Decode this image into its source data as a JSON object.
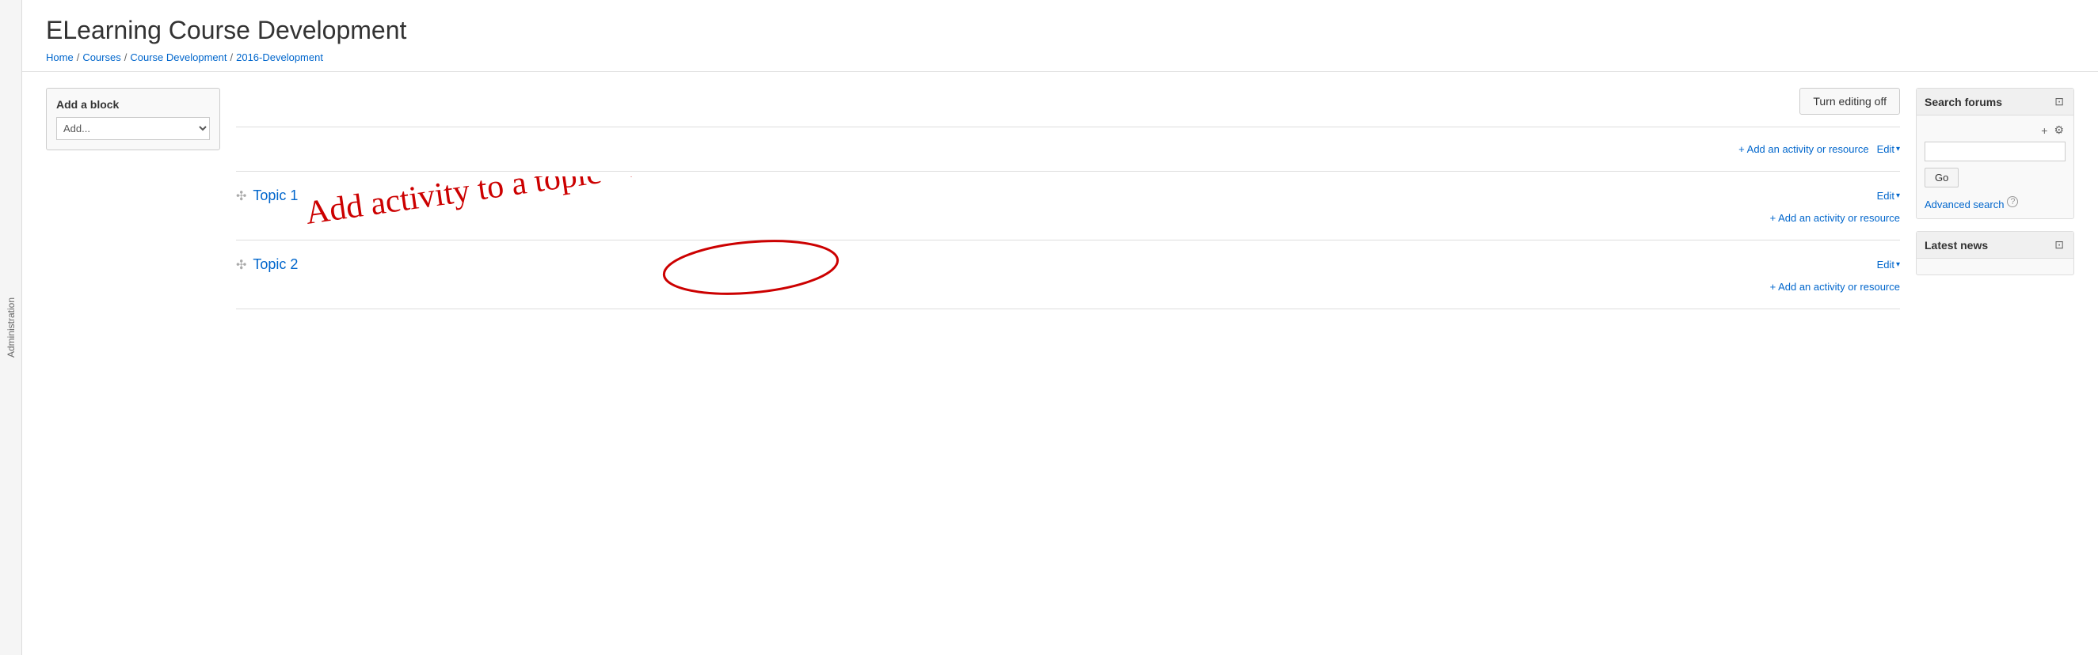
{
  "admin_sidebar": {
    "label": "Administration"
  },
  "header": {
    "title": "ELearning Course Development",
    "breadcrumb": [
      {
        "label": "Home",
        "href": "#"
      },
      {
        "label": "Courses",
        "href": "#"
      },
      {
        "label": "Course Development",
        "href": "#"
      },
      {
        "label": "2016-Development",
        "href": "#"
      }
    ]
  },
  "toolbar": {
    "turn_editing_off": "Turn editing off"
  },
  "left_sidebar": {
    "add_block_title": "Add a block",
    "add_select_placeholder": "Add..."
  },
  "main": {
    "sections": [
      {
        "id": "intro",
        "has_topic_label": false,
        "add_activity_label": "+ Add an activity or resource",
        "edit_label": "Edit"
      },
      {
        "id": "topic1",
        "has_topic_label": true,
        "topic_title": "Topic 1",
        "add_activity_label": "+ Add an activity or resource",
        "edit_label": "Edit"
      },
      {
        "id": "topic2",
        "has_topic_label": true,
        "topic_title": "Topic 2",
        "add_activity_label": "+ Add an activity or resource",
        "edit_label": "Edit"
      }
    ]
  },
  "right_sidebar": {
    "search_forums_block": {
      "title": "Search forums",
      "search_placeholder": "",
      "go_btn_label": "Go",
      "advanced_search_label": "Advanced search"
    },
    "latest_news_block": {
      "title": "Latest news"
    }
  }
}
